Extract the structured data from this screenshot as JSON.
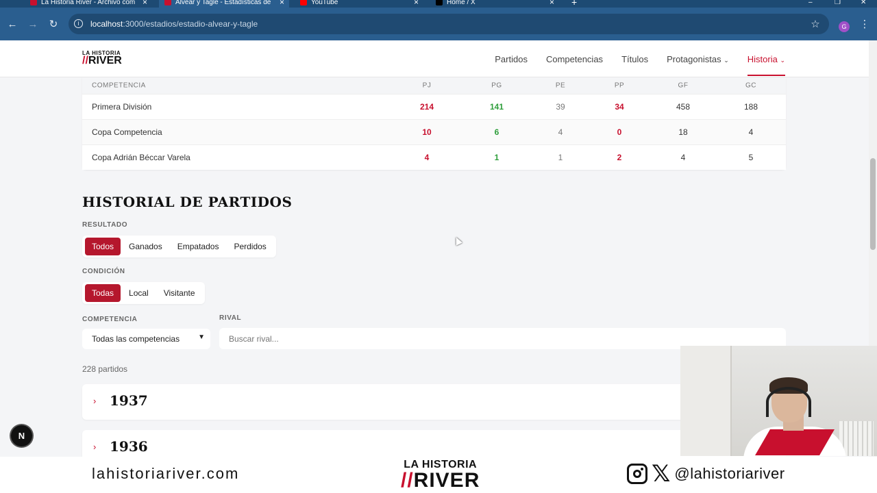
{
  "browser": {
    "tabs": [
      {
        "title": "La Historia River - Archivo com",
        "favicon": "red-flag"
      },
      {
        "title": "Alvear y Tagle - Estadísticas de",
        "favicon": "red-flag"
      },
      {
        "title": "YouTube",
        "favicon": "youtube"
      },
      {
        "title": "Home / X",
        "favicon": "x"
      }
    ],
    "url_host": "localhost",
    "url_path": ":3000/estadios/estadio-alvear-y-tagle",
    "profile_initial": "G"
  },
  "site": {
    "logo_top": "LA HISTORIA",
    "logo_mark": "//",
    "logo_name": "RIVER",
    "nav": [
      "Partidos",
      "Competencias",
      "Títulos",
      "Protagonistas",
      "Historia"
    ],
    "nav_active": "Historia"
  },
  "stats": {
    "headers": [
      "COMPETENCIA",
      "PJ",
      "PG",
      "PE",
      "PP",
      "GF",
      "GC"
    ],
    "rows": [
      {
        "name": "Primera División",
        "pj": "214",
        "pg": "141",
        "pe": "39",
        "pp": "34",
        "gf": "458",
        "gc": "188"
      },
      {
        "name": "Copa Competencia",
        "pj": "10",
        "pg": "6",
        "pe": "4",
        "pp": "0",
        "gf": "18",
        "gc": "4"
      },
      {
        "name": "Copa Adrián Béccar Varela",
        "pj": "4",
        "pg": "1",
        "pe": "1",
        "pp": "2",
        "gf": "4",
        "gc": "5"
      }
    ]
  },
  "historial": {
    "title": "HISTORIAL DE PARTIDOS",
    "resultado_label": "RESULTADO",
    "resultado_opts": [
      "Todos",
      "Ganados",
      "Empatados",
      "Perdidos"
    ],
    "condicion_label": "CONDICIÓN",
    "condicion_opts": [
      "Todas",
      "Local",
      "Visitante"
    ],
    "competencia_label": "COMPETENCIA",
    "competencia_value": "Todas las competencias",
    "rival_label": "RIVAL",
    "rival_placeholder": "Buscar rival...",
    "count": "228 partidos",
    "years": [
      "1937",
      "1936"
    ]
  },
  "dev_badge": "N",
  "footer": {
    "website": "lahistoriariver.com",
    "logo_top": "LA HISTORIA",
    "logo_mark": "//",
    "logo_name": "RIVER",
    "handle": "@lahistoriariver"
  }
}
